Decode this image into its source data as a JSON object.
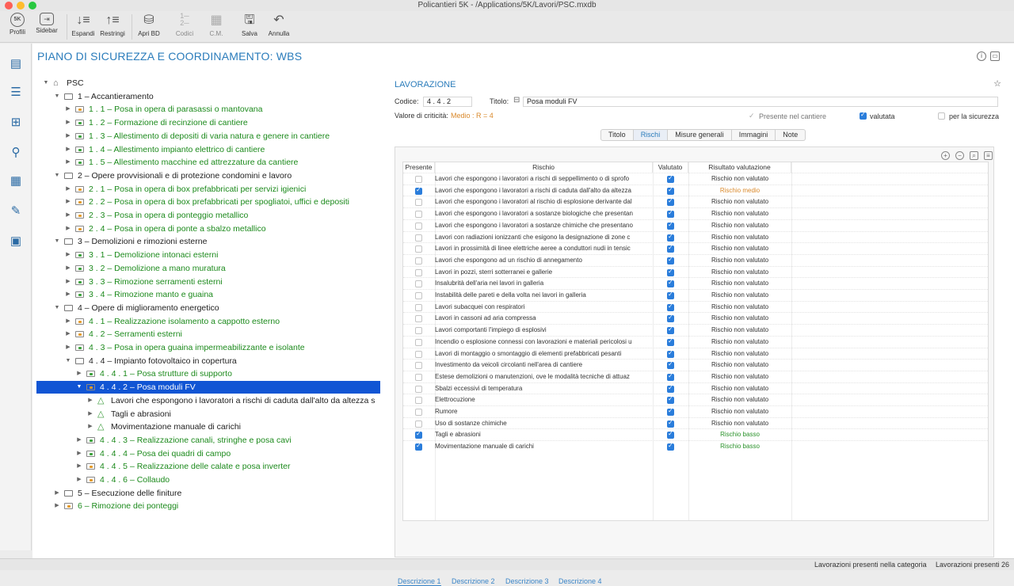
{
  "window": {
    "title": "Policantieri 5K - /Applications/5K/Lavori/PSC.mxdb"
  },
  "toolbar": {
    "items": [
      {
        "label": "Profili",
        "icon": "5k-profile-icon"
      },
      {
        "label": "Sidebar",
        "icon": "sidebar-icon"
      },
      {
        "label": "Espandi",
        "icon": "expand-icon"
      },
      {
        "label": "Restringi",
        "icon": "collapse-icon"
      },
      {
        "label": "Apri BD",
        "icon": "database-icon"
      },
      {
        "label": "Codici",
        "icon": "codes-icon"
      },
      {
        "label": "C.M.",
        "icon": "grid-icon"
      },
      {
        "label": "Salva",
        "icon": "save-icon"
      },
      {
        "label": "Annulla",
        "icon": "undo-icon"
      }
    ]
  },
  "page": {
    "title": "PIANO DI SICUREZZA E COORDINAMENTO: WBS"
  },
  "tree": [
    {
      "label": "PSC",
      "type": "home",
      "level": 0,
      "expanded": true
    },
    {
      "label": "1 – Accantieramento",
      "type": "folder",
      "level": 1,
      "expanded": true
    },
    {
      "label": "1 . 1 – Posa in opera di parasassi o mantovana",
      "type": "task",
      "mark": "orange",
      "level": 2
    },
    {
      "label": "1 . 2 – Formazione di recinzione di cantiere",
      "type": "task",
      "mark": "green",
      "level": 2
    },
    {
      "label": "1 . 3 – Allestimento di depositi di varia natura e genere in cantiere",
      "type": "task",
      "mark": "green",
      "level": 2
    },
    {
      "label": "1 . 4 – Allestimento impianto elettrico di cantiere",
      "type": "task",
      "mark": "green",
      "level": 2
    },
    {
      "label": "1 . 5 – Allestimento macchine ed attrezzature da cantiere",
      "type": "task",
      "mark": "green",
      "level": 2
    },
    {
      "label": "2 – Opere provvisionali e di protezione condomini e lavoro",
      "type": "folder",
      "level": 1,
      "expanded": true
    },
    {
      "label": "2 . 1 – Posa in opera di box prefabbricati per servizi igienici",
      "type": "task",
      "mark": "orange",
      "level": 2
    },
    {
      "label": "2 . 2 – Posa in opera di box prefabbricati per spogliatoi, uffici e depositi",
      "type": "task",
      "mark": "orange",
      "level": 2
    },
    {
      "label": "2 . 3 – Posa in opera di ponteggio metallico",
      "type": "task",
      "mark": "orange",
      "level": 2
    },
    {
      "label": "2 . 4 – Posa in opera di ponte a sbalzo metallico",
      "type": "task",
      "mark": "orange",
      "level": 2
    },
    {
      "label": "3 – Demolizioni e rimozioni esterne",
      "type": "folder",
      "level": 1,
      "expanded": true
    },
    {
      "label": "3 . 1 – Demolizione intonaci esterni",
      "type": "task",
      "mark": "green",
      "level": 2
    },
    {
      "label": "3 . 2 – Demolizione a mano muratura",
      "type": "task",
      "mark": "green",
      "level": 2
    },
    {
      "label": "3 . 3 – Rimozione serramenti esterni",
      "type": "task",
      "mark": "green",
      "level": 2
    },
    {
      "label": "3 . 4 – Rimozione manto e guaina",
      "type": "task",
      "mark": "green",
      "level": 2
    },
    {
      "label": "4 – Opere di miglioramento energetico",
      "type": "folder",
      "level": 1,
      "expanded": true
    },
    {
      "label": "4 . 1 – Realizzazione isolamento a cappotto esterno",
      "type": "task",
      "mark": "orange",
      "level": 2
    },
    {
      "label": "4 . 2 – Serramenti esterni",
      "type": "task",
      "mark": "orange",
      "level": 2
    },
    {
      "label": "4 . 3 – Posa in opera guaina impermeabilizzante e isolante",
      "type": "task",
      "mark": "green",
      "level": 2
    },
    {
      "label": "4 . 4 – Impianto fotovoltaico in copertura",
      "type": "folder",
      "level": 2,
      "expanded": true,
      "plain": true
    },
    {
      "label": "4 . 4 . 1 – Posa strutture di supporto",
      "type": "task",
      "mark": "green",
      "level": 3
    },
    {
      "label": "4 . 4 . 2 – Posa moduli FV",
      "type": "task",
      "mark": "orange",
      "level": 3,
      "selected": true,
      "expanded": true
    },
    {
      "label": "Lavori che espongono i lavoratori a rischi di caduta dall'alto da altezza s",
      "type": "warn",
      "level": 4,
      "plain": true
    },
    {
      "label": "Tagli e abrasioni",
      "type": "warn",
      "level": 4,
      "plain": true
    },
    {
      "label": "Movimentazione manuale di carichi",
      "type": "warn",
      "level": 4,
      "plain": true
    },
    {
      "label": "4 . 4 . 3 – Realizzazione canali, stringhe e posa cavi",
      "type": "task",
      "mark": "green",
      "level": 3
    },
    {
      "label": "4 . 4 . 4 – Posa dei quadri di campo",
      "type": "task",
      "mark": "green",
      "level": 3
    },
    {
      "label": "4 . 4 . 5 – Realizzazione delle calate e posa inverter",
      "type": "task",
      "mark": "orange",
      "level": 3
    },
    {
      "label": "4 . 4 . 6 – Collaudo",
      "type": "task",
      "mark": "orange",
      "level": 3
    },
    {
      "label": "5 – Esecuzione delle finiture",
      "type": "folder",
      "level": 1,
      "plain": true
    },
    {
      "label": "6 – Rimozione dei ponteggi",
      "type": "task",
      "mark": "orange",
      "level": 1
    }
  ],
  "detail": {
    "section_title": "LAVORAZIONE",
    "codice_label": "Codice:",
    "codice_value": "4 . 4 . 2",
    "titolo_label": "Titolo:",
    "titolo_value": "Posa moduli FV",
    "criticita_label": "Valore di criticità:",
    "criticita_value": "Medio : R = 4",
    "presente_label": "Presente nel cantiere",
    "valutata_label": "valutata",
    "sicurezza_label": "per la sicurezza",
    "tabs": [
      "Titolo",
      "Rischi",
      "Misure generali",
      "Immagini",
      "Note"
    ],
    "active_tab": "Rischi",
    "columns": [
      "Presente",
      "Rischio",
      "Valutato",
      "Risultato valutazione"
    ],
    "rows": [
      {
        "present": false,
        "risk": "Lavori che espongono i lavoratori a rischi di seppellimento o di sprofo",
        "valutato": true,
        "result": "Rischio non valutato",
        "color": "normal"
      },
      {
        "present": true,
        "risk": "Lavori che espongono i lavoratori a rischi di caduta dall'alto da altezza",
        "valutato": true,
        "result": "Rischio medio",
        "color": "orange"
      },
      {
        "present": false,
        "risk": "Lavori che espongono i lavoratori al rischio di esplosione derivante dal",
        "valutato": true,
        "result": "Rischio non valutato",
        "color": "normal"
      },
      {
        "present": false,
        "risk": "Lavori che espongono i lavoratori a sostanze biologiche che presentan",
        "valutato": true,
        "result": "Rischio non valutato",
        "color": "normal"
      },
      {
        "present": false,
        "risk": "Lavori che espongono i lavoratori a sostanze chimiche che presentano",
        "valutato": true,
        "result": "Rischio non valutato",
        "color": "normal"
      },
      {
        "present": false,
        "risk": "Lavori con radiazioni ionizzanti che esigono la designazione di zone c",
        "valutato": true,
        "result": "Rischio non valutato",
        "color": "normal"
      },
      {
        "present": false,
        "risk": "Lavori in prossimità di linee elettriche aeree a conduttori nudi in tensic",
        "valutato": true,
        "result": "Rischio non valutato",
        "color": "normal"
      },
      {
        "present": false,
        "risk": "Lavori che espongono ad un rischio di annegamento",
        "valutato": true,
        "result": "Rischio non valutato",
        "color": "normal"
      },
      {
        "present": false,
        "risk": "Lavori in pozzi, sterri sotterranei e gallerie",
        "valutato": true,
        "result": "Rischio non valutato",
        "color": "normal"
      },
      {
        "present": false,
        "risk": "Insalubrità dell'aria nei lavori in galleria",
        "valutato": true,
        "result": "Rischio non valutato",
        "color": "normal"
      },
      {
        "present": false,
        "risk": "Instabilità delle pareti e della volta nei lavori in galleria",
        "valutato": true,
        "result": "Rischio non valutato",
        "color": "normal"
      },
      {
        "present": false,
        "risk": "Lavori subacquei con respiratori",
        "valutato": true,
        "result": "Rischio non valutato",
        "color": "normal"
      },
      {
        "present": false,
        "risk": "Lavori in cassoni ad aria compressa",
        "valutato": true,
        "result": "Rischio non valutato",
        "color": "normal"
      },
      {
        "present": false,
        "risk": "Lavori comportanti l'impiego di esplosivi",
        "valutato": true,
        "result": "Rischio non valutato",
        "color": "normal"
      },
      {
        "present": false,
        "risk": "Incendio o esplosione connessi con lavorazioni e materiali pericolosi u",
        "valutato": true,
        "result": "Rischio non valutato",
        "color": "normal"
      },
      {
        "present": false,
        "risk": "Lavori di montaggio o smontaggio di elementi prefabbricati pesanti",
        "valutato": true,
        "result": "Rischio non valutato",
        "color": "normal"
      },
      {
        "present": false,
        "risk": "Investimento da veicoli circolanti nell'area di cantiere",
        "valutato": true,
        "result": "Rischio non valutato",
        "color": "normal"
      },
      {
        "present": false,
        "risk": "Estese demolizioni o manutenzioni, ove le modalità tecniche di attuaz",
        "valutato": true,
        "result": "Rischio non valutato",
        "color": "normal"
      },
      {
        "present": false,
        "risk": "Sbalzi eccessivi di temperatura",
        "valutato": true,
        "result": "Rischio non valutato",
        "color": "normal"
      },
      {
        "present": false,
        "risk": "Elettrocuzione",
        "valutato": true,
        "result": "Rischio non valutato",
        "color": "normal"
      },
      {
        "present": false,
        "risk": "Rumore",
        "valutato": true,
        "result": "Rischio non valutato",
        "color": "normal"
      },
      {
        "present": false,
        "risk": "Uso di sostanze chimiche",
        "valutato": true,
        "result": "Rischio non valutato",
        "color": "normal"
      },
      {
        "present": true,
        "risk": "Tagli e abrasioni",
        "valutato": true,
        "result": "Rischio basso",
        "color": "green"
      },
      {
        "present": true,
        "risk": "Movimentazione manuale di carichi",
        "valutato": true,
        "result": "Rischio basso",
        "color": "green"
      }
    ],
    "desc_tabs": [
      "Descrizione 1",
      "Descrizione 2",
      "Descrizione 3",
      "Descrizione 4"
    ],
    "active_desc": "Descrizione 1"
  },
  "status": {
    "left": "Lavorazioni presenti nella categoria",
    "right": "Lavorazioni presenti 26"
  },
  "colors": {
    "accent": "#2a7cbb",
    "selection": "#1155d4",
    "green_text": "#1c8a1c",
    "orange_mark": "#e39a2a"
  }
}
